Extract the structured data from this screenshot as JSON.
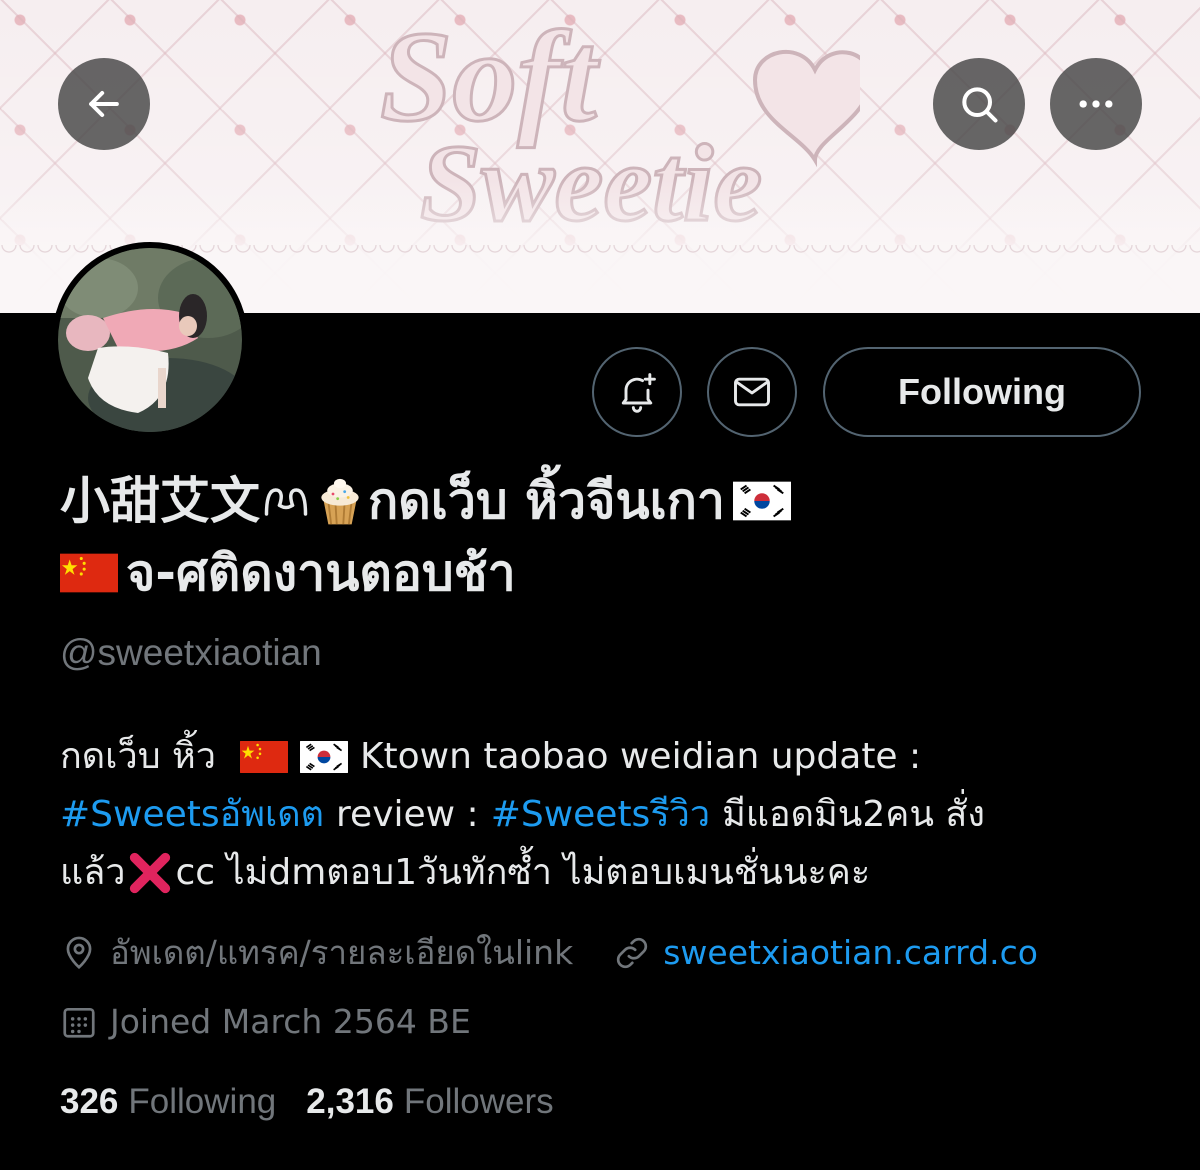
{
  "banner": {
    "logo_line1": "Soft",
    "logo_line2": "Sweetie"
  },
  "header": {
    "back_icon": "arrow-left-icon",
    "search_icon": "search-icon",
    "more_icon": "more-horizontal-icon"
  },
  "actions": {
    "notify_icon": "bell-plus-icon",
    "message_icon": "envelope-icon",
    "follow_label": "Following"
  },
  "profile": {
    "name_part1": "小甜艾文",
    "name_part2": "กดเว็บ หิ้วจีนเกา",
    "name_part3": "จ-ศติดงานตอบช้า",
    "handle": "@sweetxiaotian"
  },
  "bio": {
    "l1_text": "กดเว็บ หิ้ว",
    "l1_text2": "Ktown taobao weidian update :",
    "l2_tag1": "#Sweetsอัพเดต",
    "l2_text": "review :",
    "l2_tag2": "#Sweetsรีวิว",
    "l2_text2": "มีแอดมิน2คน สั่ง",
    "l3_text": "แล้ว",
    "l3_text2": "cc ไม่dmตอบ1วันทักซ้ำ ไม่ตอบเมนชั่นนะคะ"
  },
  "meta": {
    "location": "อัพเดต/แทรค/รายละเอียดในlink",
    "website": "sweetxiaotian.carrd.co",
    "joined": "Joined March 2564 BE"
  },
  "stats": {
    "following_count": "326",
    "following_label": "Following",
    "followers_count": "2,316",
    "followers_label": "Followers"
  },
  "colors": {
    "background": "#000000",
    "text": "#e7e9ea",
    "secondary": "#71767b",
    "link": "#1d9bf0",
    "button_border": "#536471"
  }
}
